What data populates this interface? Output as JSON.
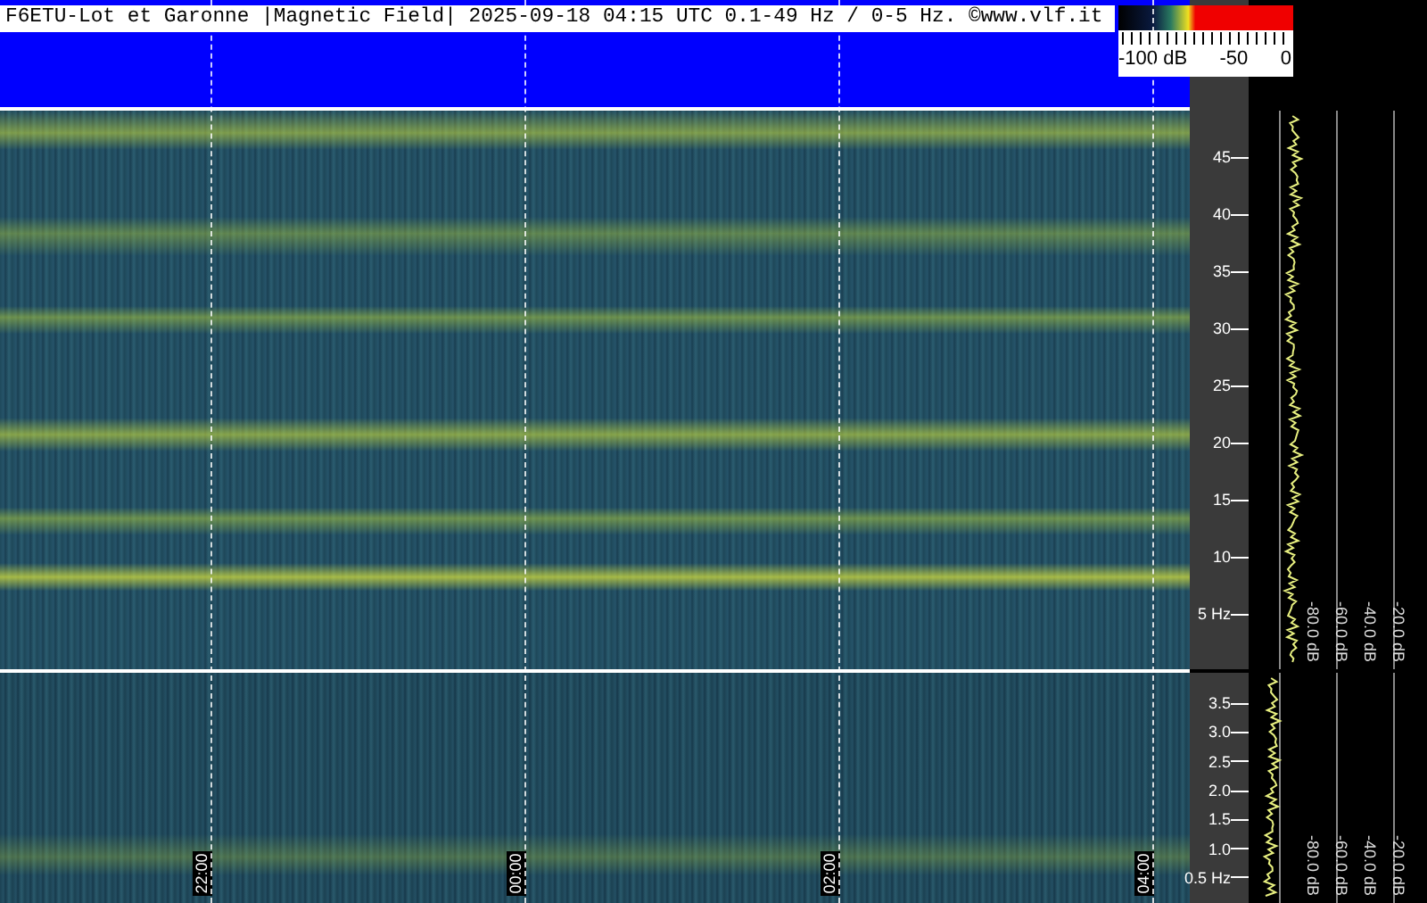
{
  "title": "F6ETU-Lot et Garonne |Magnetic Field| 2025-09-18 04:15 UTC 0.1-49 Hz / 0-5 Hz. ©www.vlf.it",
  "color_scale": {
    "labels": [
      "-100 dB",
      "-50",
      "0"
    ]
  },
  "upper_panel": {
    "freq_labels": [
      "45",
      "40",
      "35",
      "30",
      "25",
      "20",
      "15",
      "10",
      "5 Hz"
    ],
    "db_labels": [
      "-80.0 dB",
      "-60.0 dB",
      "-40.0 dB",
      "-20.0 dB"
    ]
  },
  "lower_panel": {
    "freq_labels": [
      "3.5",
      "3.0",
      "2.5",
      "2.0",
      "1.5",
      "1.0",
      "0.5 Hz"
    ],
    "db_labels": [
      "-80.0 dB",
      "-60.0 dB",
      "-40.0 dB",
      "-20.0 dB"
    ]
  },
  "time_labels": [
    "22:00",
    "00:00",
    "02:00",
    "04:00"
  ]
}
